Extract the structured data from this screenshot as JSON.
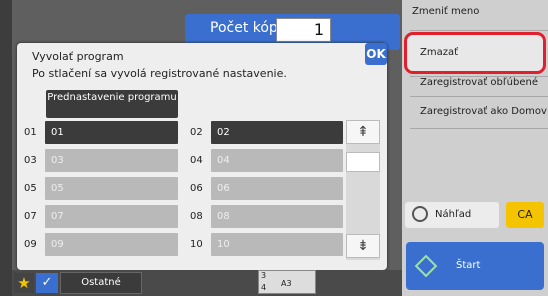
{
  "header": {
    "copies_label": "Počet kópií",
    "copies_value": "1"
  },
  "right_panel": {
    "items": [
      "Zmeniť meno",
      "Zmazať",
      "Zaregistrovať obľúbené",
      "Zaregistrovať ako Domov"
    ],
    "preview_label": "Náhľad",
    "ca_label": "CA",
    "start_label": "Štart"
  },
  "dialog": {
    "title": "Vyvolať program",
    "subtitle": "Po stlačení sa vyvolá registrované nastavenie.",
    "ok_label": "OK",
    "preset_button": "Prednastavenie programu",
    "slots": [
      {
        "num": "01",
        "label": "01",
        "registered": true
      },
      {
        "num": "02",
        "label": "02",
        "registered": true
      },
      {
        "num": "03",
        "label": "03",
        "registered": false
      },
      {
        "num": "04",
        "label": "04",
        "registered": false
      },
      {
        "num": "05",
        "label": "05",
        "registered": false
      },
      {
        "num": "06",
        "label": "06",
        "registered": false
      },
      {
        "num": "07",
        "label": "07",
        "registered": false
      },
      {
        "num": "08",
        "label": "08",
        "registered": false
      },
      {
        "num": "09",
        "label": "09",
        "registered": false
      },
      {
        "num": "10",
        "label": "10",
        "registered": false
      }
    ]
  },
  "bottom_bar": {
    "other_label": "Ostatné",
    "paper_label": "A3",
    "tray_numbers": [
      "3",
      "4"
    ]
  },
  "colors": {
    "accent": "#3a6fd0",
    "highlight": "#e0202c",
    "ca": "#f5c400"
  }
}
